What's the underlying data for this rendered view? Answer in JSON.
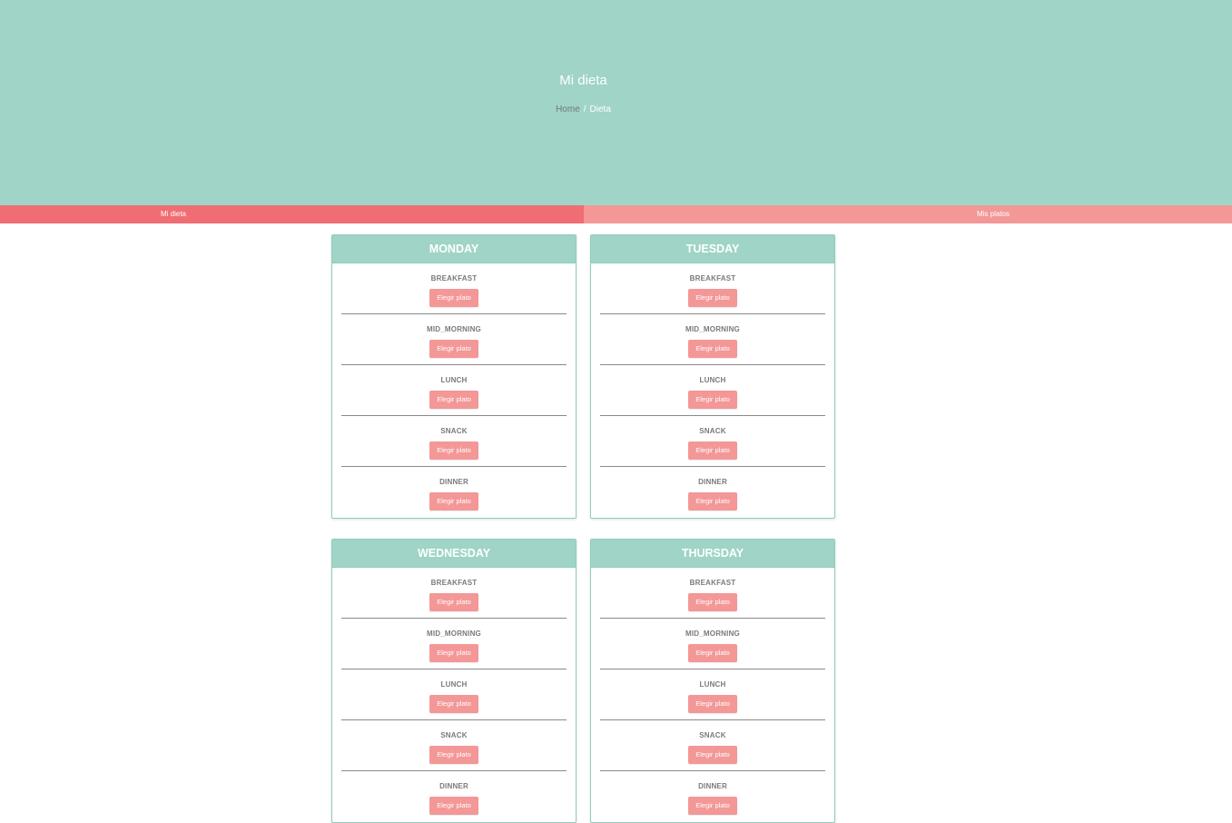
{
  "hero": {
    "title": "Mi dieta",
    "breadcrumb": {
      "home": "Home",
      "separator": "/",
      "current": "Dieta"
    }
  },
  "tabs": [
    {
      "label": "Mi dieta",
      "active": true
    },
    {
      "label": "Mis platos",
      "active": false
    }
  ],
  "colors": {
    "hero_bg": "#9fd4c6",
    "tab_active": "#f06d73",
    "tab_inactive": "#f39797",
    "button": "#f39797"
  },
  "days": [
    {
      "name": "MONDAY",
      "meals": [
        {
          "label": "BREAKFAST",
          "button": "Elegir plato"
        },
        {
          "label": "MID_MORNING",
          "button": "Elegir plato"
        },
        {
          "label": "LUNCH",
          "button": "Elegir plato"
        },
        {
          "label": "SNACK",
          "button": "Elegir plato"
        },
        {
          "label": "DINNER",
          "button": "Elegir plato"
        }
      ]
    },
    {
      "name": "TUESDAY",
      "meals": [
        {
          "label": "BREAKFAST",
          "button": "Elegir plato"
        },
        {
          "label": "MID_MORNING",
          "button": "Elegir plato"
        },
        {
          "label": "LUNCH",
          "button": "Elegir plato"
        },
        {
          "label": "SNACK",
          "button": "Elegir plato"
        },
        {
          "label": "DINNER",
          "button": "Elegir plato"
        }
      ]
    },
    {
      "name": "WEDNESDAY",
      "meals": [
        {
          "label": "BREAKFAST",
          "button": "Elegir plato"
        },
        {
          "label": "MID_MORNING",
          "button": "Elegir plato"
        },
        {
          "label": "LUNCH",
          "button": "Elegir plato"
        },
        {
          "label": "SNACK",
          "button": "Elegir plato"
        },
        {
          "label": "DINNER",
          "button": "Elegir plato"
        }
      ]
    },
    {
      "name": "THURSDAY",
      "meals": [
        {
          "label": "BREAKFAST",
          "button": "Elegir plato"
        },
        {
          "label": "MID_MORNING",
          "button": "Elegir plato"
        },
        {
          "label": "LUNCH",
          "button": "Elegir plato"
        },
        {
          "label": "SNACK",
          "button": "Elegir plato"
        },
        {
          "label": "DINNER",
          "button": "Elegir plato"
        }
      ]
    }
  ]
}
